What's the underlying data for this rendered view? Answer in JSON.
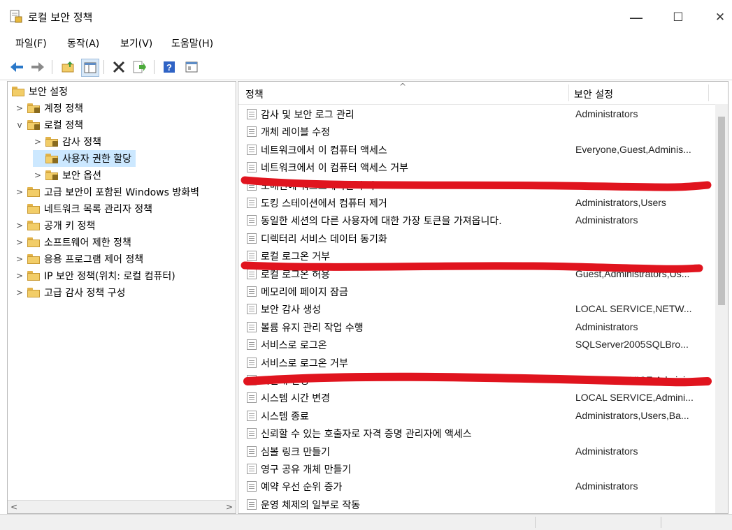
{
  "window": {
    "title": "로컬 보안 정책",
    "minimize": "—",
    "maximize": "☐",
    "close": "✕"
  },
  "menu": [
    "파일(F)",
    "동작(A)",
    "보기(V)",
    "도움말(H)"
  ],
  "toolbar": {
    "icons": [
      "back-arrow-icon",
      "forward-arrow-icon",
      "up-folder-icon",
      "show-hide-tree-icon",
      "delete-icon",
      "export-list-icon",
      "help-icon",
      "properties-view-icon"
    ]
  },
  "tree": [
    {
      "label": "보안 설정",
      "level": 0,
      "expander": "",
      "selected": false
    },
    {
      "label": "계정 정책",
      "level": 1,
      "expander": ">",
      "selected": false
    },
    {
      "label": "로컬 정책",
      "level": 1,
      "expander": "v",
      "selected": false
    },
    {
      "label": "감사 정책",
      "level": 2,
      "expander": ">",
      "selected": false
    },
    {
      "label": "사용자 권한 할당",
      "level": 2,
      "expander": "",
      "selected": true
    },
    {
      "label": "보안 옵션",
      "level": 2,
      "expander": ">",
      "selected": false
    },
    {
      "label": "고급 보안이 포함된 Windows 방화벽",
      "level": 1,
      "expander": ">",
      "selected": false
    },
    {
      "label": "네트워크 목록 관리자 정책",
      "level": 1,
      "expander": "",
      "selected": false
    },
    {
      "label": "공개 키 정책",
      "level": 1,
      "expander": ">",
      "selected": false
    },
    {
      "label": "소프트웨어 제한 정책",
      "level": 1,
      "expander": ">",
      "selected": false
    },
    {
      "label": "응용 프로그램 제어 정책",
      "level": 1,
      "expander": ">",
      "selected": false
    },
    {
      "label": "IP 보안 정책(위치: 로컬 컴퓨터)",
      "level": 1,
      "expander": ">",
      "selected": false
    },
    {
      "label": "고급 감사 정책 구성",
      "level": 1,
      "expander": ">",
      "selected": false
    }
  ],
  "list": {
    "col_policy": "정책",
    "col_setting": "보안 설정",
    "sort_glyph": "^",
    "rows": [
      {
        "policy": "감사 및 보안 로그 관리",
        "setting": "Administrators"
      },
      {
        "policy": "개체 레이블 수정",
        "setting": ""
      },
      {
        "policy": "네트워크에서 이 컴퓨터 액세스",
        "setting": "Everyone,Guest,Adminis..."
      },
      {
        "policy": "네트워크에서 이 컴퓨터 액세스 거부",
        "setting": ""
      },
      {
        "policy": "도메인에 워크스테이션 추가",
        "setting": ""
      },
      {
        "policy": "도킹 스테이션에서 컴퓨터 제거",
        "setting": "Administrators,Users"
      },
      {
        "policy": "동일한 세션의 다른 사용자에 대한 가장 토큰을 가져옵니다.",
        "setting": "Administrators"
      },
      {
        "policy": "디렉터리 서비스 데이터 동기화",
        "setting": ""
      },
      {
        "policy": "로컬 로그온 거부",
        "setting": ""
      },
      {
        "policy": "로컬 로그온 허용",
        "setting": "Guest,Administrators,Us..."
      },
      {
        "policy": "메모리에 페이지 잠금",
        "setting": ""
      },
      {
        "policy": "보안 감사 생성",
        "setting": "LOCAL SERVICE,NETW..."
      },
      {
        "policy": "볼륨 유지 관리 작업 수행",
        "setting": "Administrators"
      },
      {
        "policy": "서비스로 로그온",
        "setting": "SQLServer2005SQLBro..."
      },
      {
        "policy": "서비스로 로그온 거부",
        "setting": ""
      },
      {
        "policy": "시간대 변경",
        "setting": "LOCAL SERVICE,Admini..."
      },
      {
        "policy": "시스템 시간 변경",
        "setting": "LOCAL SERVICE,Admini..."
      },
      {
        "policy": "시스템 종료",
        "setting": "Administrators,Users,Ba..."
      },
      {
        "policy": "신뢰할 수 있는 호출자로 자격 증명 관리자에 액세스",
        "setting": ""
      },
      {
        "policy": "심볼 링크 만들기",
        "setting": "Administrators"
      },
      {
        "policy": "영구 공유 개체 만들기",
        "setting": ""
      },
      {
        "policy": "예약 우선 순위 증가",
        "setting": "Administrators"
      },
      {
        "policy": "운영 체제의 일부로 작동",
        "setting": ""
      }
    ]
  },
  "scroll": {
    "left_arrow": "<",
    "right_arrow": ">"
  },
  "colors": {
    "selection": "#cce8ff",
    "redaction": "#e0141e",
    "folder": "#f2cd68"
  }
}
